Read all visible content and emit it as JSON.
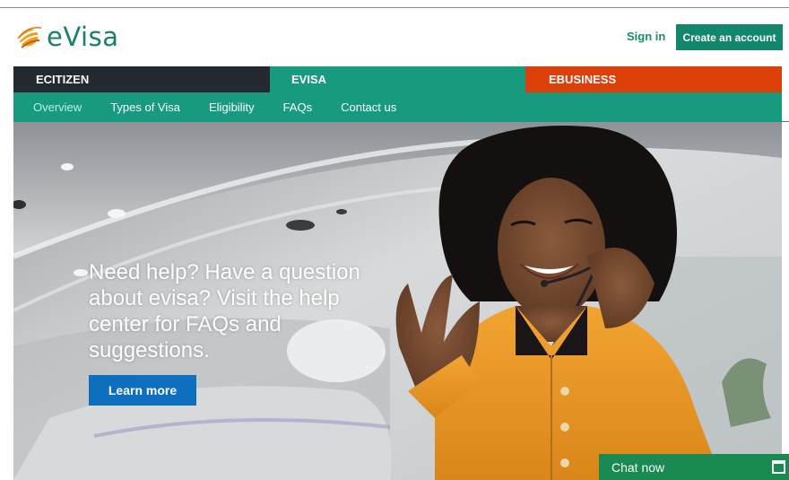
{
  "brand": {
    "name": "eVisa",
    "primary_color": "#12876c",
    "dark_color": "#23292e",
    "accent_color": "#dd3f0b"
  },
  "header": {
    "sign_in_label": "Sign in",
    "create_account_label": "Create an account"
  },
  "portal_tabs": [
    {
      "label": "ECITIZEN",
      "color": "#23292e"
    },
    {
      "label": "EVISA",
      "color": "#179a7e",
      "active": true
    },
    {
      "label": "EBUSINESS",
      "color": "#dd3f0b"
    }
  ],
  "sub_nav": {
    "items": [
      {
        "label": "Overview",
        "active": true
      },
      {
        "label": "Types of Visa"
      },
      {
        "label": "Eligibility"
      },
      {
        "label": "FAQs"
      },
      {
        "label": "Contact us"
      }
    ]
  },
  "hero": {
    "headline": "Need help? Have a question about evisa? Visit the help center for FAQs and suggestions.",
    "cta_label": "Learn more",
    "cta_color": "#0e6fbf"
  },
  "chat": {
    "label": "Chat now",
    "icon": "chat-window-icon",
    "color": "#188a52"
  }
}
